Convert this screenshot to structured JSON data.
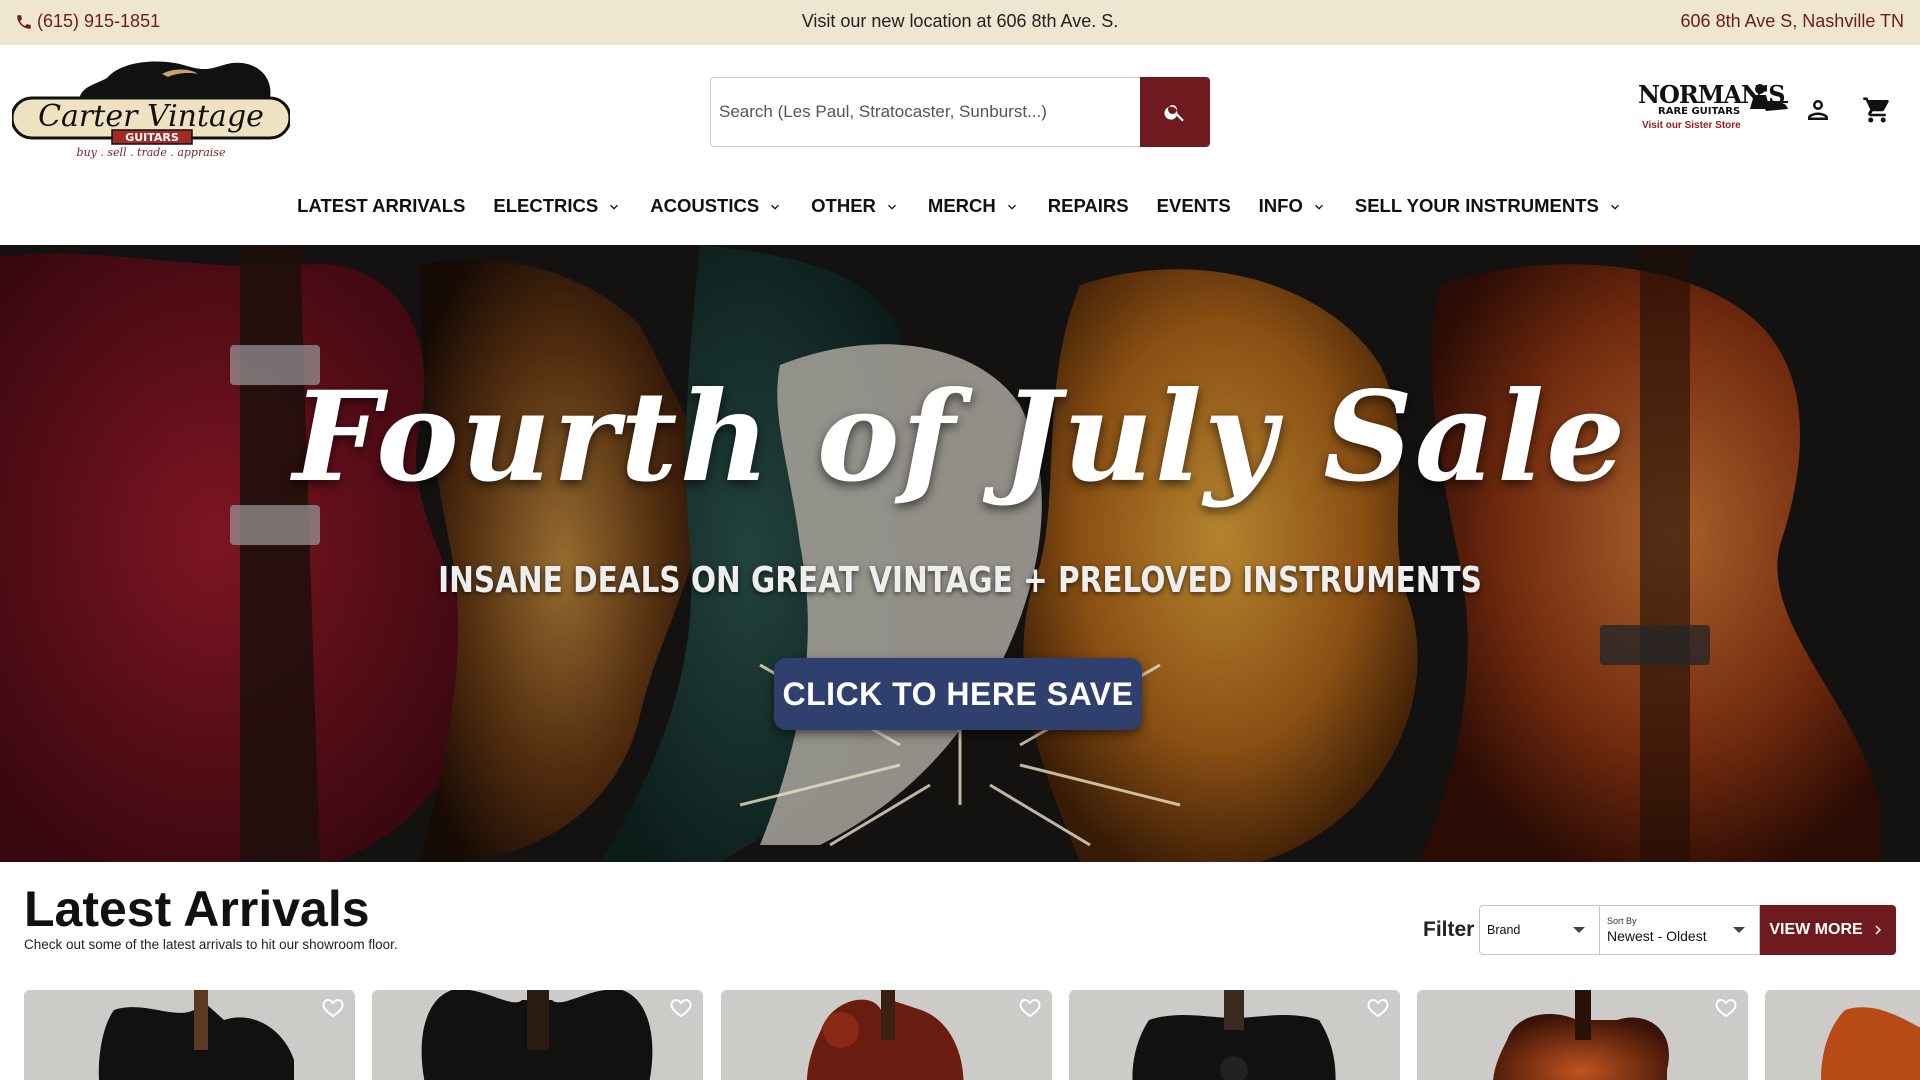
{
  "topbar": {
    "phone": "(615) 915-1851",
    "announcement": "Visit our new location at 606 8th Ave. S.",
    "address": "606 8th Ave S, Nashville TN"
  },
  "header": {
    "logo": {
      "name": "Carter Vintage",
      "sub": "GUITARS",
      "tagline": "buy . sell . trade . appraise"
    },
    "search": {
      "placeholder": "Search (Les Paul, Stratocaster, Sunburst...)"
    },
    "sister_store": {
      "brand": "NORMAN'S",
      "brand_sub": "RARE GUITARS",
      "visit": "Visit our Sister Store"
    },
    "icons": [
      "account-icon",
      "cart-icon"
    ]
  },
  "nav": {
    "items": [
      {
        "label": "LATEST ARRIVALS",
        "dropdown": false
      },
      {
        "label": "ELECTRICS",
        "dropdown": true
      },
      {
        "label": "ACOUSTICS",
        "dropdown": true
      },
      {
        "label": "OTHER",
        "dropdown": true
      },
      {
        "label": "MERCH",
        "dropdown": true
      },
      {
        "label": "REPAIRS",
        "dropdown": false
      },
      {
        "label": "EVENTS",
        "dropdown": false
      },
      {
        "label": "INFO",
        "dropdown": true
      },
      {
        "label": "SELL YOUR INSTRUMENTS",
        "dropdown": true
      }
    ]
  },
  "hero": {
    "title": "Fourth of July Sale",
    "subtitle": "INSANE DEALS ON GREAT VINTAGE + PRELOVED INSTRUMENTS",
    "cta": "CLICK TO HERE SAVE",
    "colors": {
      "cta": "#2f3f6e"
    }
  },
  "arrivals": {
    "title": "Latest Arrivals",
    "subtitle": "Check out some of the latest arrivals to hit our showroom floor.",
    "filter_label": "Filter",
    "brand_select": {
      "value": "Brand"
    },
    "sort_select": {
      "caption": "Sort By",
      "value": "Newest - Oldest"
    },
    "view_more": "VIEW MORE"
  },
  "colors": {
    "brand": "#6e1a1e",
    "topbar_bg": "#efe6d2"
  }
}
